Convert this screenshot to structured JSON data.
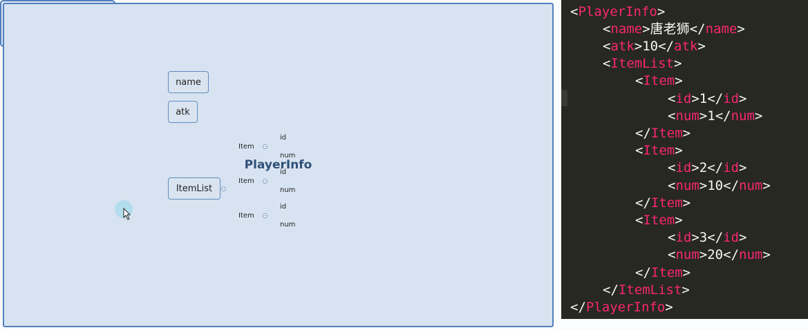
{
  "mindmap": {
    "root": "PlayerInfo",
    "children": [
      "name",
      "atk",
      "ItemList"
    ],
    "items": [
      {
        "label": "Item",
        "fields": [
          "id",
          "num"
        ]
      },
      {
        "label": "Item",
        "fields": [
          "id",
          "num"
        ]
      },
      {
        "label": "Item",
        "fields": [
          "id",
          "num"
        ]
      }
    ]
  },
  "code": {
    "lines": [
      {
        "indent": 0,
        "open": "PlayerInfo",
        "text": "",
        "close": ""
      },
      {
        "indent": 1,
        "open": "name",
        "text": "唐老狮",
        "close": "name"
      },
      {
        "indent": 1,
        "open": "atk",
        "text": "10",
        "close": "atk"
      },
      {
        "indent": 1,
        "open": "ItemList",
        "text": "",
        "close": ""
      },
      {
        "indent": 2,
        "open": "Item",
        "text": "",
        "close": ""
      },
      {
        "indent": 3,
        "open": "id",
        "text": "1",
        "close": "id"
      },
      {
        "indent": 3,
        "open": "num",
        "text": "1",
        "close": "num"
      },
      {
        "indent": 2,
        "open": "",
        "text": "",
        "close": "Item"
      },
      {
        "indent": 2,
        "open": "Item",
        "text": "",
        "close": ""
      },
      {
        "indent": 3,
        "open": "id",
        "text": "2",
        "close": "id"
      },
      {
        "indent": 3,
        "open": "num",
        "text": "10",
        "close": "num"
      },
      {
        "indent": 2,
        "open": "",
        "text": "",
        "close": "Item"
      },
      {
        "indent": 2,
        "open": "Item",
        "text": "",
        "close": ""
      },
      {
        "indent": 3,
        "open": "id",
        "text": "3",
        "close": "id"
      },
      {
        "indent": 3,
        "open": "num",
        "text": "20",
        "close": "num"
      },
      {
        "indent": 2,
        "open": "",
        "text": "",
        "close": "Item"
      },
      {
        "indent": 1,
        "open": "",
        "text": "",
        "close": "ItemList"
      },
      {
        "indent": 0,
        "open": "",
        "text": "",
        "close": "PlayerInfo"
      }
    ]
  },
  "colors": {
    "tag": "#f92672",
    "editor_bg": "#272822",
    "node_border": "#5f8bbd",
    "node_fill": "#d9e4f0"
  }
}
